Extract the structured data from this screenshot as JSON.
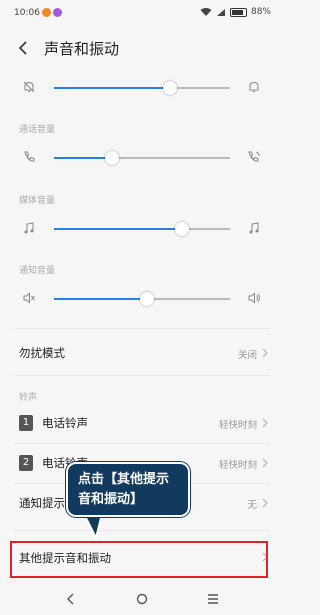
{
  "status": {
    "time": "10:06",
    "battery": "88%",
    "battery_level": 0.88
  },
  "header": {
    "title": "声音和振动"
  },
  "sliders": [
    {
      "id": "ringer",
      "section": "",
      "level": 0.66,
      "left_icon": "bell-off-icon",
      "right_icon": "bell-icon"
    },
    {
      "id": "call",
      "section": "通话音量",
      "level": 0.33,
      "left_icon": "phone-icon",
      "right_icon": "phone-volume-icon"
    },
    {
      "id": "media",
      "section": "媒体音量",
      "level": 0.73,
      "left_icon": "music-note-icon",
      "right_icon": "music-note-icon"
    },
    {
      "id": "notify",
      "section": "通知音量",
      "level": 0.53,
      "left_icon": "speaker-mute-icon",
      "right_icon": "speaker-icon"
    }
  ],
  "dnd": {
    "label": "勿扰模式",
    "value": "关闭"
  },
  "ringtone_section": "铃声",
  "sim1": {
    "badge": "1",
    "label": "电话铃声",
    "value": "轻快时刻"
  },
  "sim2": {
    "badge": "2",
    "label": "电话铃声",
    "value": "轻快时刻"
  },
  "notification": {
    "label": "通知提示音",
    "value": "无"
  },
  "other": {
    "label": "其他提示音和振动"
  },
  "callout": {
    "text": "点击【其他提示音和振动】"
  },
  "colors": {
    "accent": "#2b7de9",
    "highlight": "#e3212a",
    "callout_bg": "#123a5e"
  },
  "nav": {
    "back": "back-icon",
    "home": "home-icon",
    "menu": "menu-icon"
  }
}
